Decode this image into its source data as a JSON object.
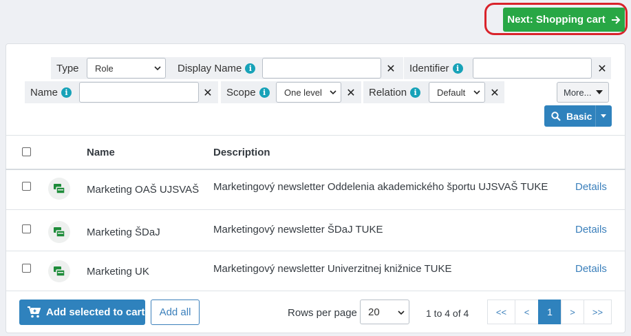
{
  "header": {
    "next_label": "Next: Shopping cart"
  },
  "filters": {
    "type": {
      "label": "Type",
      "value": "Role"
    },
    "display_name": {
      "label": "Display Name",
      "value": ""
    },
    "identifier": {
      "label": "Identifier",
      "value": ""
    },
    "name": {
      "label": "Name",
      "value": ""
    },
    "scope": {
      "label": "Scope",
      "value": "One level"
    },
    "relation": {
      "label": "Relation",
      "value": "Default"
    },
    "more_label": "More...",
    "basic_label": "Basic",
    "clear_glyph": "✕",
    "info_glyph": "i"
  },
  "table": {
    "columns": {
      "name": "Name",
      "description": "Description"
    },
    "rows": [
      {
        "name": "Marketing OAŠ UJSVAŠ",
        "description": "Marketingový newsletter Oddelenia akademického športu UJSVAŠ TUKE",
        "action": "Details"
      },
      {
        "name": "Marketing ŠDaJ",
        "description": "Marketingový newsletter ŠDaJ TUKE",
        "action": "Details"
      },
      {
        "name": "Marketing UK",
        "description": "Marketingový newsletter Univerzitnej knižnice TUKE",
        "action": "Details"
      }
    ]
  },
  "footer": {
    "add_selected_label": "Add selected to cart",
    "add_all_label": "Add all",
    "rows_per_page_label": "Rows per page",
    "rows_per_page_value": "20",
    "range_text": "1 to 4 of 4",
    "pager": {
      "first": "<<",
      "prev": "<",
      "current": "1",
      "next": ">",
      "last": ">>"
    }
  },
  "colors": {
    "success": "#28a745",
    "primary": "#2f82bd",
    "info": "#17a2b8",
    "highlight": "#d9232b",
    "role_icon": "#1e8c3a"
  },
  "icons": {
    "next": "arrow-right-icon",
    "search": "search-icon",
    "cart": "cart-icon",
    "role": "role-icon",
    "caret": "chevron-down-icon"
  }
}
